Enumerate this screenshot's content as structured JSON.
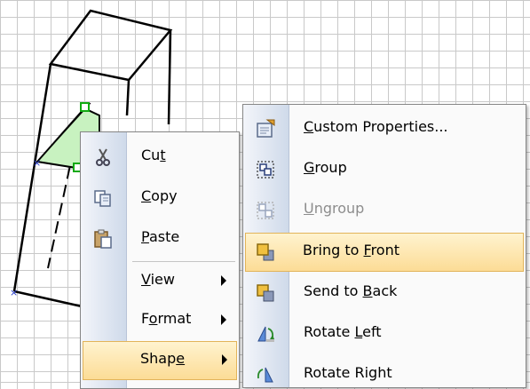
{
  "context_menu": {
    "items": [
      {
        "label_pre": "Cu",
        "label_key": "t",
        "label_post": "",
        "icon": "scissors-icon"
      },
      {
        "label_pre": "",
        "label_key": "C",
        "label_post": "opy",
        "icon": "copy-icon"
      },
      {
        "label_pre": "",
        "label_key": "P",
        "label_post": "aste",
        "icon": "paste-icon"
      },
      {
        "label_pre": "",
        "label_key": "V",
        "label_post": "iew",
        "icon": "",
        "submenu": true
      },
      {
        "label_pre": "F",
        "label_key": "o",
        "label_post": "rmat",
        "icon": "",
        "submenu": true
      },
      {
        "label_pre": "Shap",
        "label_key": "e",
        "label_post": "",
        "icon": "",
        "submenu": true,
        "highlighted": true
      }
    ]
  },
  "shape_submenu": {
    "items": [
      {
        "label_pre": "",
        "label_key": "C",
        "label_post": "ustom Properties...",
        "icon": "custom-properties-icon"
      },
      {
        "label_pre": "",
        "label_key": "G",
        "label_post": "roup",
        "icon": "group-icon"
      },
      {
        "label_pre": "",
        "label_key": "U",
        "label_post": "ngroup",
        "icon": "ungroup-icon",
        "disabled": true
      },
      {
        "label_pre": "Bring to ",
        "label_key": "F",
        "label_post": "ront",
        "icon": "bring-to-front-icon",
        "highlighted": true
      },
      {
        "label_pre": "Send to ",
        "label_key": "B",
        "label_post": "ack",
        "icon": "send-to-back-icon"
      },
      {
        "label_pre": "Rotate ",
        "label_key": "L",
        "label_post": "eft",
        "icon": "rotate-left-icon"
      },
      {
        "label_pre": "Rotate Right",
        "label_key": "",
        "label_post": "",
        "icon": "rotate-right-icon"
      }
    ]
  },
  "colors": {
    "highlight_top": "#fff3cf",
    "highlight_bottom": "#fcdc96",
    "highlight_border": "#e2b45a",
    "shape_fill": "#c8f2c0",
    "selection_handle": "#11aa11",
    "gutter": "#cfdaea"
  }
}
